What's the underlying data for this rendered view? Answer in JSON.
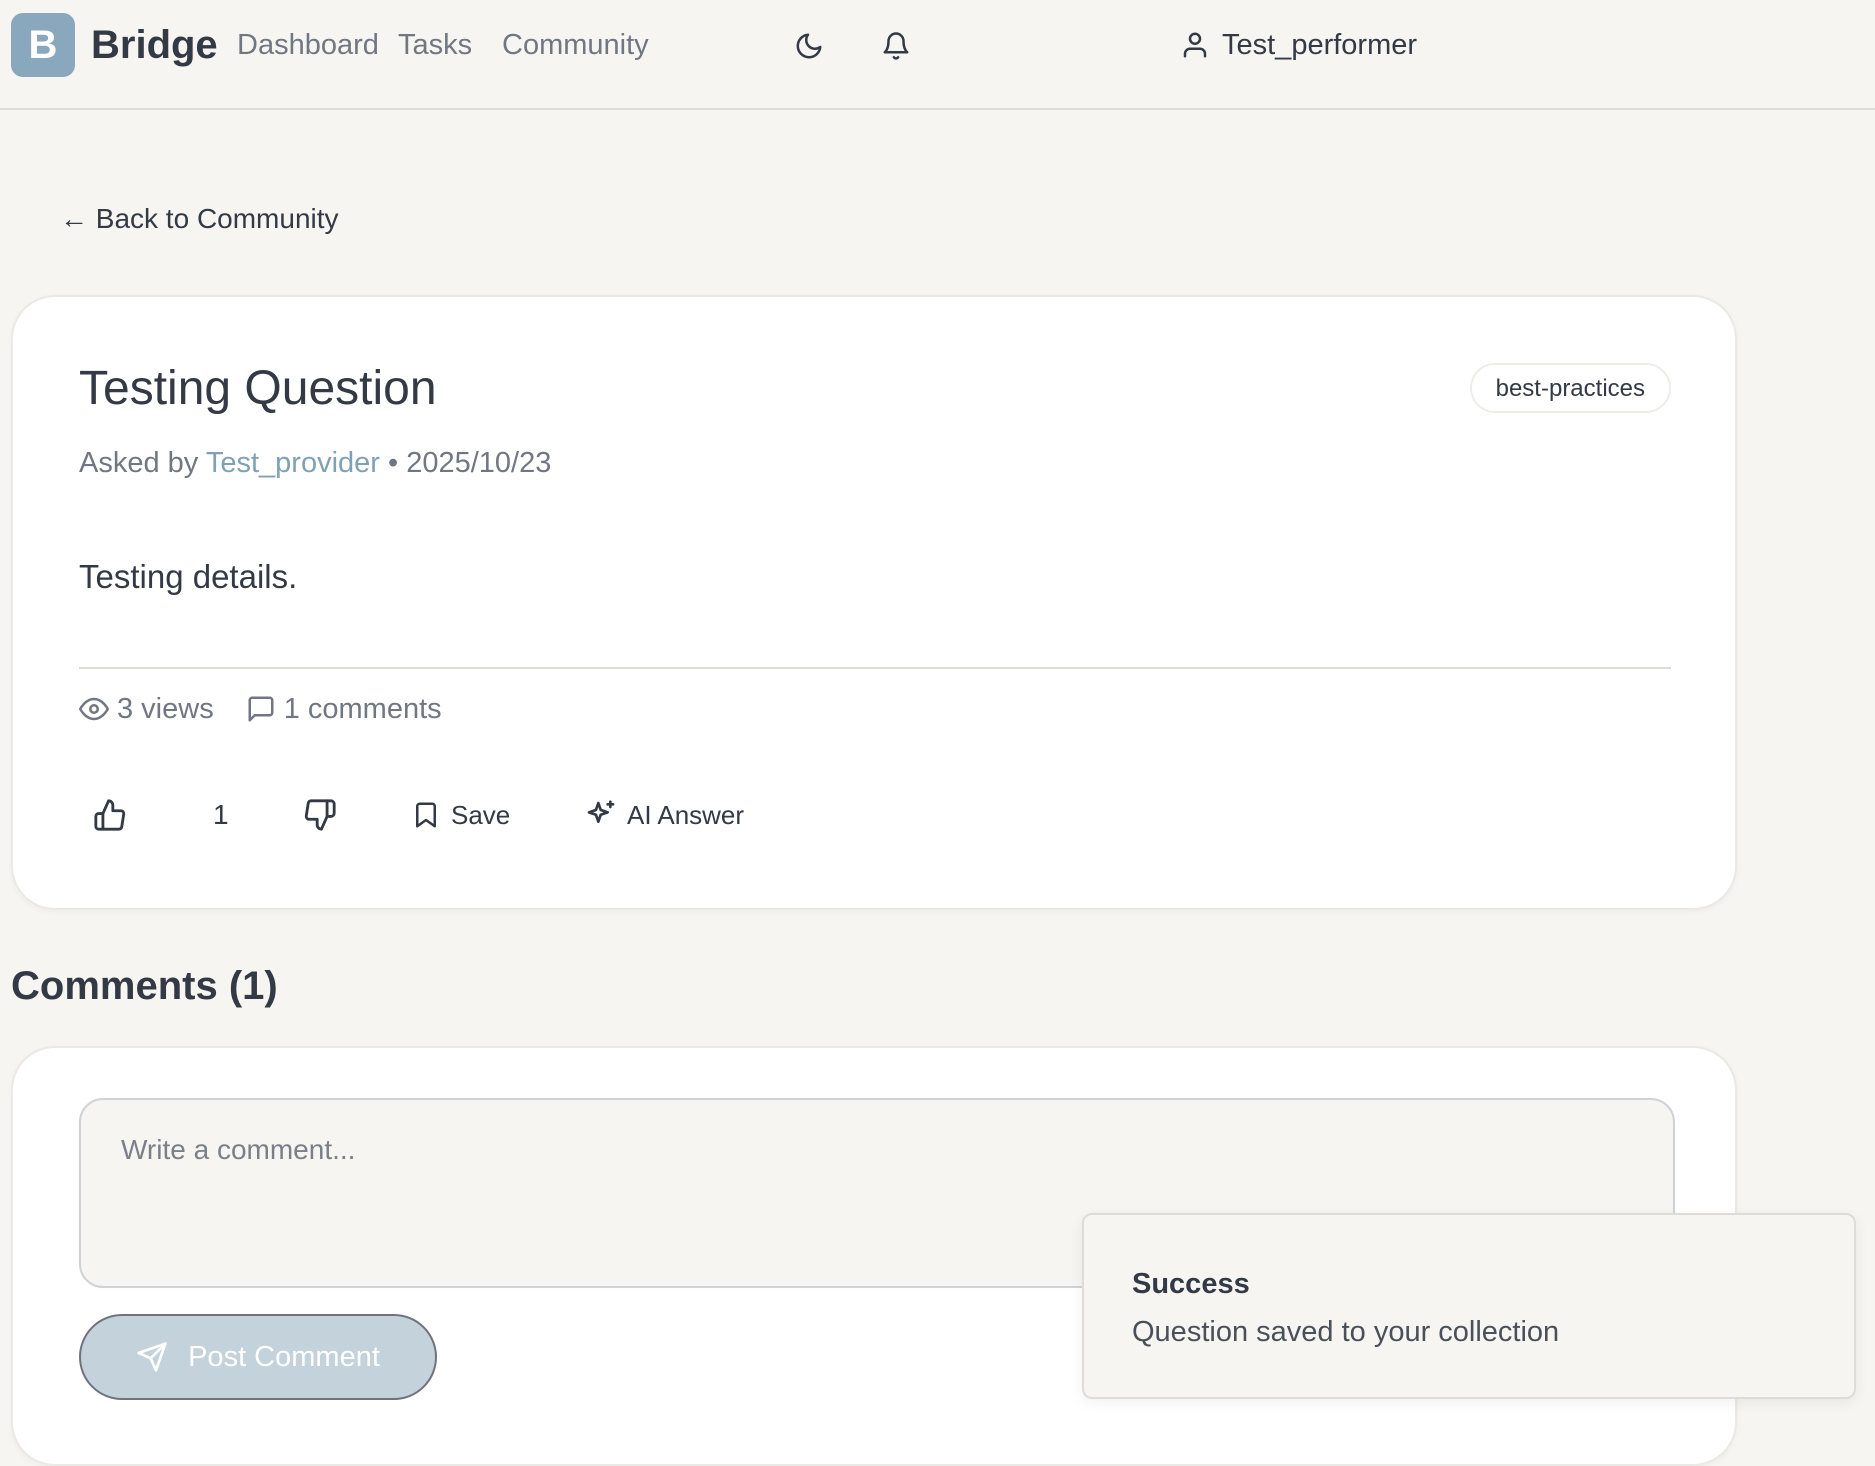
{
  "app": {
    "logo_letter": "B",
    "name": "Bridge"
  },
  "nav": {
    "items": [
      {
        "label": "Dashboard"
      },
      {
        "label": "Tasks"
      },
      {
        "label": "Community"
      }
    ]
  },
  "header": {
    "theme_icon": "moon-icon",
    "notification_icon": "bell-icon",
    "user_icon": "user-icon",
    "username": "Test_performer"
  },
  "back_link": "← Back to Community",
  "question": {
    "title": "Testing Question",
    "tag": "best-practices",
    "asked_by_prefix": "Asked by",
    "author": "Test_provider",
    "separator": "•",
    "date": "2025/10/23",
    "body": "Testing details.",
    "views": "3 views",
    "comments": "1 comments",
    "vote_count": "1",
    "save_label": "Save",
    "ai_answer_label": "AI Answer"
  },
  "comments_section": {
    "heading": "Comments (1)",
    "input_placeholder": "Write a comment...",
    "post_button_label": "Post Comment"
  },
  "toast": {
    "title": "Success",
    "message": "Question saved to your collection"
  },
  "colors": {
    "background": "#f6f5f2",
    "logo": "#8aa8bd",
    "author_link": "#7fa1b4",
    "post_button": "#c4d2db",
    "text": "#333a45",
    "muted_text": "#717782"
  }
}
